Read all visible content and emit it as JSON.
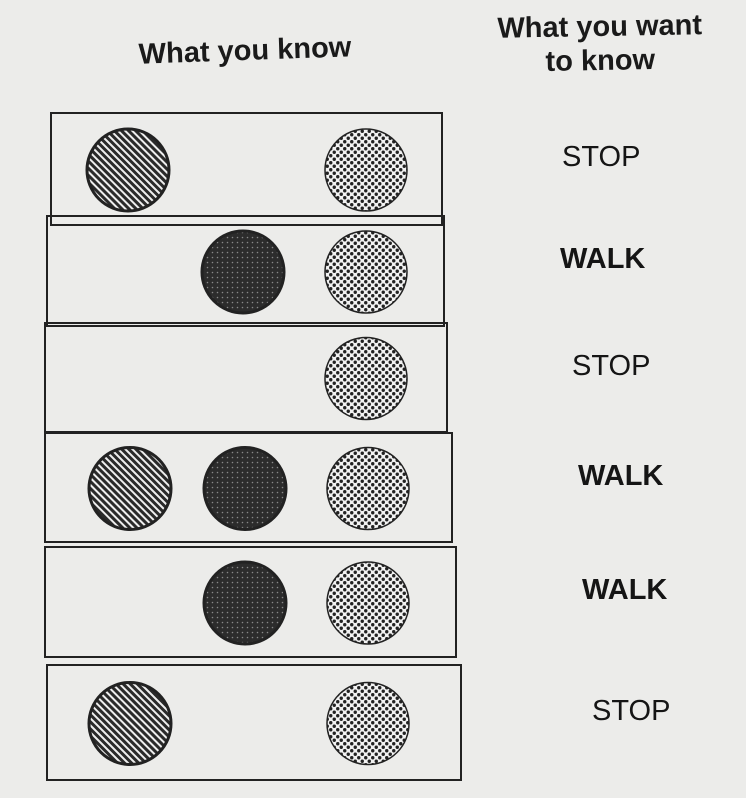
{
  "headers": {
    "known": "What you know",
    "want": "What you want\nto know"
  },
  "light_types": [
    "hatched",
    "dark",
    "dotted"
  ],
  "rows": [
    {
      "lights": [
        true,
        false,
        true
      ],
      "answer": "STOP",
      "bold": false
    },
    {
      "lights": [
        false,
        true,
        true
      ],
      "answer": "WALK",
      "bold": true
    },
    {
      "lights": [
        false,
        false,
        true
      ],
      "answer": "STOP",
      "bold": false
    },
    {
      "lights": [
        true,
        true,
        true
      ],
      "answer": "WALK",
      "bold": true
    },
    {
      "lights": [
        false,
        true,
        true
      ],
      "answer": "WALK",
      "bold": true
    },
    {
      "lights": [
        true,
        false,
        true
      ],
      "answer": "STOP",
      "bold": false
    }
  ],
  "colors": {
    "ink": "#222222",
    "paper": "#ececea"
  }
}
